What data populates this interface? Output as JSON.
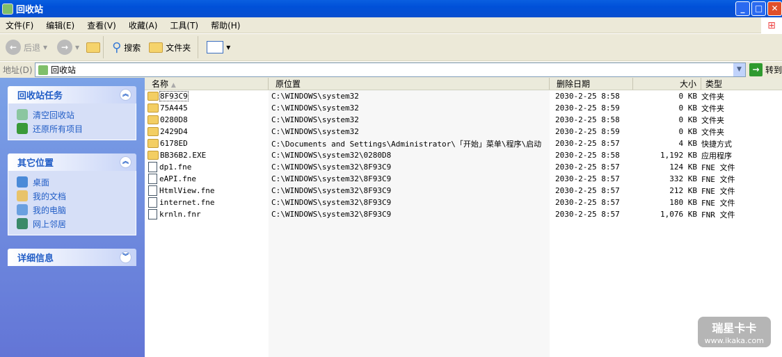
{
  "window": {
    "title": "回收站"
  },
  "menu": [
    "文件(F)",
    "编辑(E)",
    "查看(V)",
    "收藏(A)",
    "工具(T)",
    "帮助(H)"
  ],
  "toolbar": {
    "back": "后退",
    "search": "搜索",
    "folders": "文件夹"
  },
  "address": {
    "label": "地址(D)",
    "value": "回收站",
    "go": "转到"
  },
  "sidebar": {
    "tasks": {
      "title": "回收站任务",
      "items": [
        "清空回收站",
        "还原所有项目"
      ]
    },
    "places": {
      "title": "其它位置",
      "items": [
        "桌面",
        "我的文档",
        "我的电脑",
        "网上邻居"
      ]
    },
    "details": {
      "title": "详细信息"
    }
  },
  "columns": [
    "名称",
    "原位置",
    "删除日期",
    "大小",
    "类型"
  ],
  "rows": [
    {
      "name": "8F93C9",
      "location": "C:\\WINDOWS\\system32",
      "date": "2030-2-25 8:58",
      "size": "0 KB",
      "type": "文件夹",
      "icon": "folder"
    },
    {
      "name": "75A445",
      "location": "C:\\WINDOWS\\system32",
      "date": "2030-2-25 8:59",
      "size": "0 KB",
      "type": "文件夹",
      "icon": "folder"
    },
    {
      "name": "0280D8",
      "location": "C:\\WINDOWS\\system32",
      "date": "2030-2-25 8:58",
      "size": "0 KB",
      "type": "文件夹",
      "icon": "folder"
    },
    {
      "name": "2429D4",
      "location": "C:\\WINDOWS\\system32",
      "date": "2030-2-25 8:59",
      "size": "0 KB",
      "type": "文件夹",
      "icon": "folder"
    },
    {
      "name": "6178ED",
      "location": "C:\\Documents and Settings\\Administrator\\「开始」菜单\\程序\\启动",
      "date": "2030-2-25 8:57",
      "size": "4 KB",
      "type": "快捷方式",
      "icon": "shortcut"
    },
    {
      "name": "BB36B2.EXE",
      "location": "C:\\WINDOWS\\system32\\0280D8",
      "date": "2030-2-25 8:58",
      "size": "1,192 KB",
      "type": "应用程序",
      "icon": "folder"
    },
    {
      "name": "dp1.fne",
      "location": "C:\\WINDOWS\\system32\\8F93C9",
      "date": "2030-2-25 8:57",
      "size": "124 KB",
      "type": "FNE 文件",
      "icon": "file"
    },
    {
      "name": "eAPI.fne",
      "location": "C:\\WINDOWS\\system32\\8F93C9",
      "date": "2030-2-25 8:57",
      "size": "332 KB",
      "type": "FNE 文件",
      "icon": "file"
    },
    {
      "name": "HtmlView.fne",
      "location": "C:\\WINDOWS\\system32\\8F93C9",
      "date": "2030-2-25 8:57",
      "size": "212 KB",
      "type": "FNE 文件",
      "icon": "file"
    },
    {
      "name": "internet.fne",
      "location": "C:\\WINDOWS\\system32\\8F93C9",
      "date": "2030-2-25 8:57",
      "size": "180 KB",
      "type": "FNE 文件",
      "icon": "file"
    },
    {
      "name": "krnln.fnr",
      "location": "C:\\WINDOWS\\system32\\8F93C9",
      "date": "2030-2-25 8:57",
      "size": "1,076 KB",
      "type": "FNR 文件",
      "icon": "file"
    }
  ],
  "watermark": {
    "brand": "瑞星卡卡",
    "url": "www.ikaka.com"
  }
}
